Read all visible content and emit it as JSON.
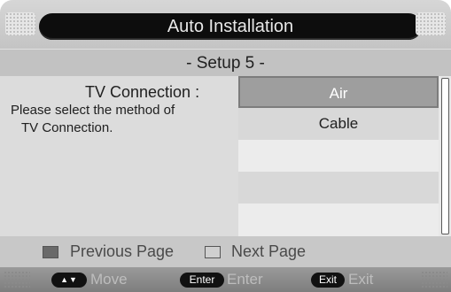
{
  "title": "Auto Installation",
  "subtitle": "- Setup 5 -",
  "prompt": {
    "label": "TV Connection :",
    "description_line1": "Please select the method of",
    "description_line2": "TV Connection."
  },
  "options": [
    {
      "label": "Air",
      "selected": true
    },
    {
      "label": "Cable",
      "selected": false
    },
    {
      "label": "",
      "selected": false
    },
    {
      "label": "",
      "selected": false
    },
    {
      "label": "",
      "selected": false
    }
  ],
  "legend": {
    "previous_page": "Previous Page",
    "next_page": "Next Page"
  },
  "help": {
    "move_key": "▲▼",
    "move_label": "Move",
    "enter_key": "Enter",
    "enter_label": "Enter",
    "exit_key": "Exit",
    "exit_label": "Exit"
  },
  "colors": {
    "selection": "#9e9e9e",
    "title_pill": "#0d0d0d",
    "previous_page_marker": "#6a6a6a",
    "next_page_marker": "#cfcfcf"
  }
}
